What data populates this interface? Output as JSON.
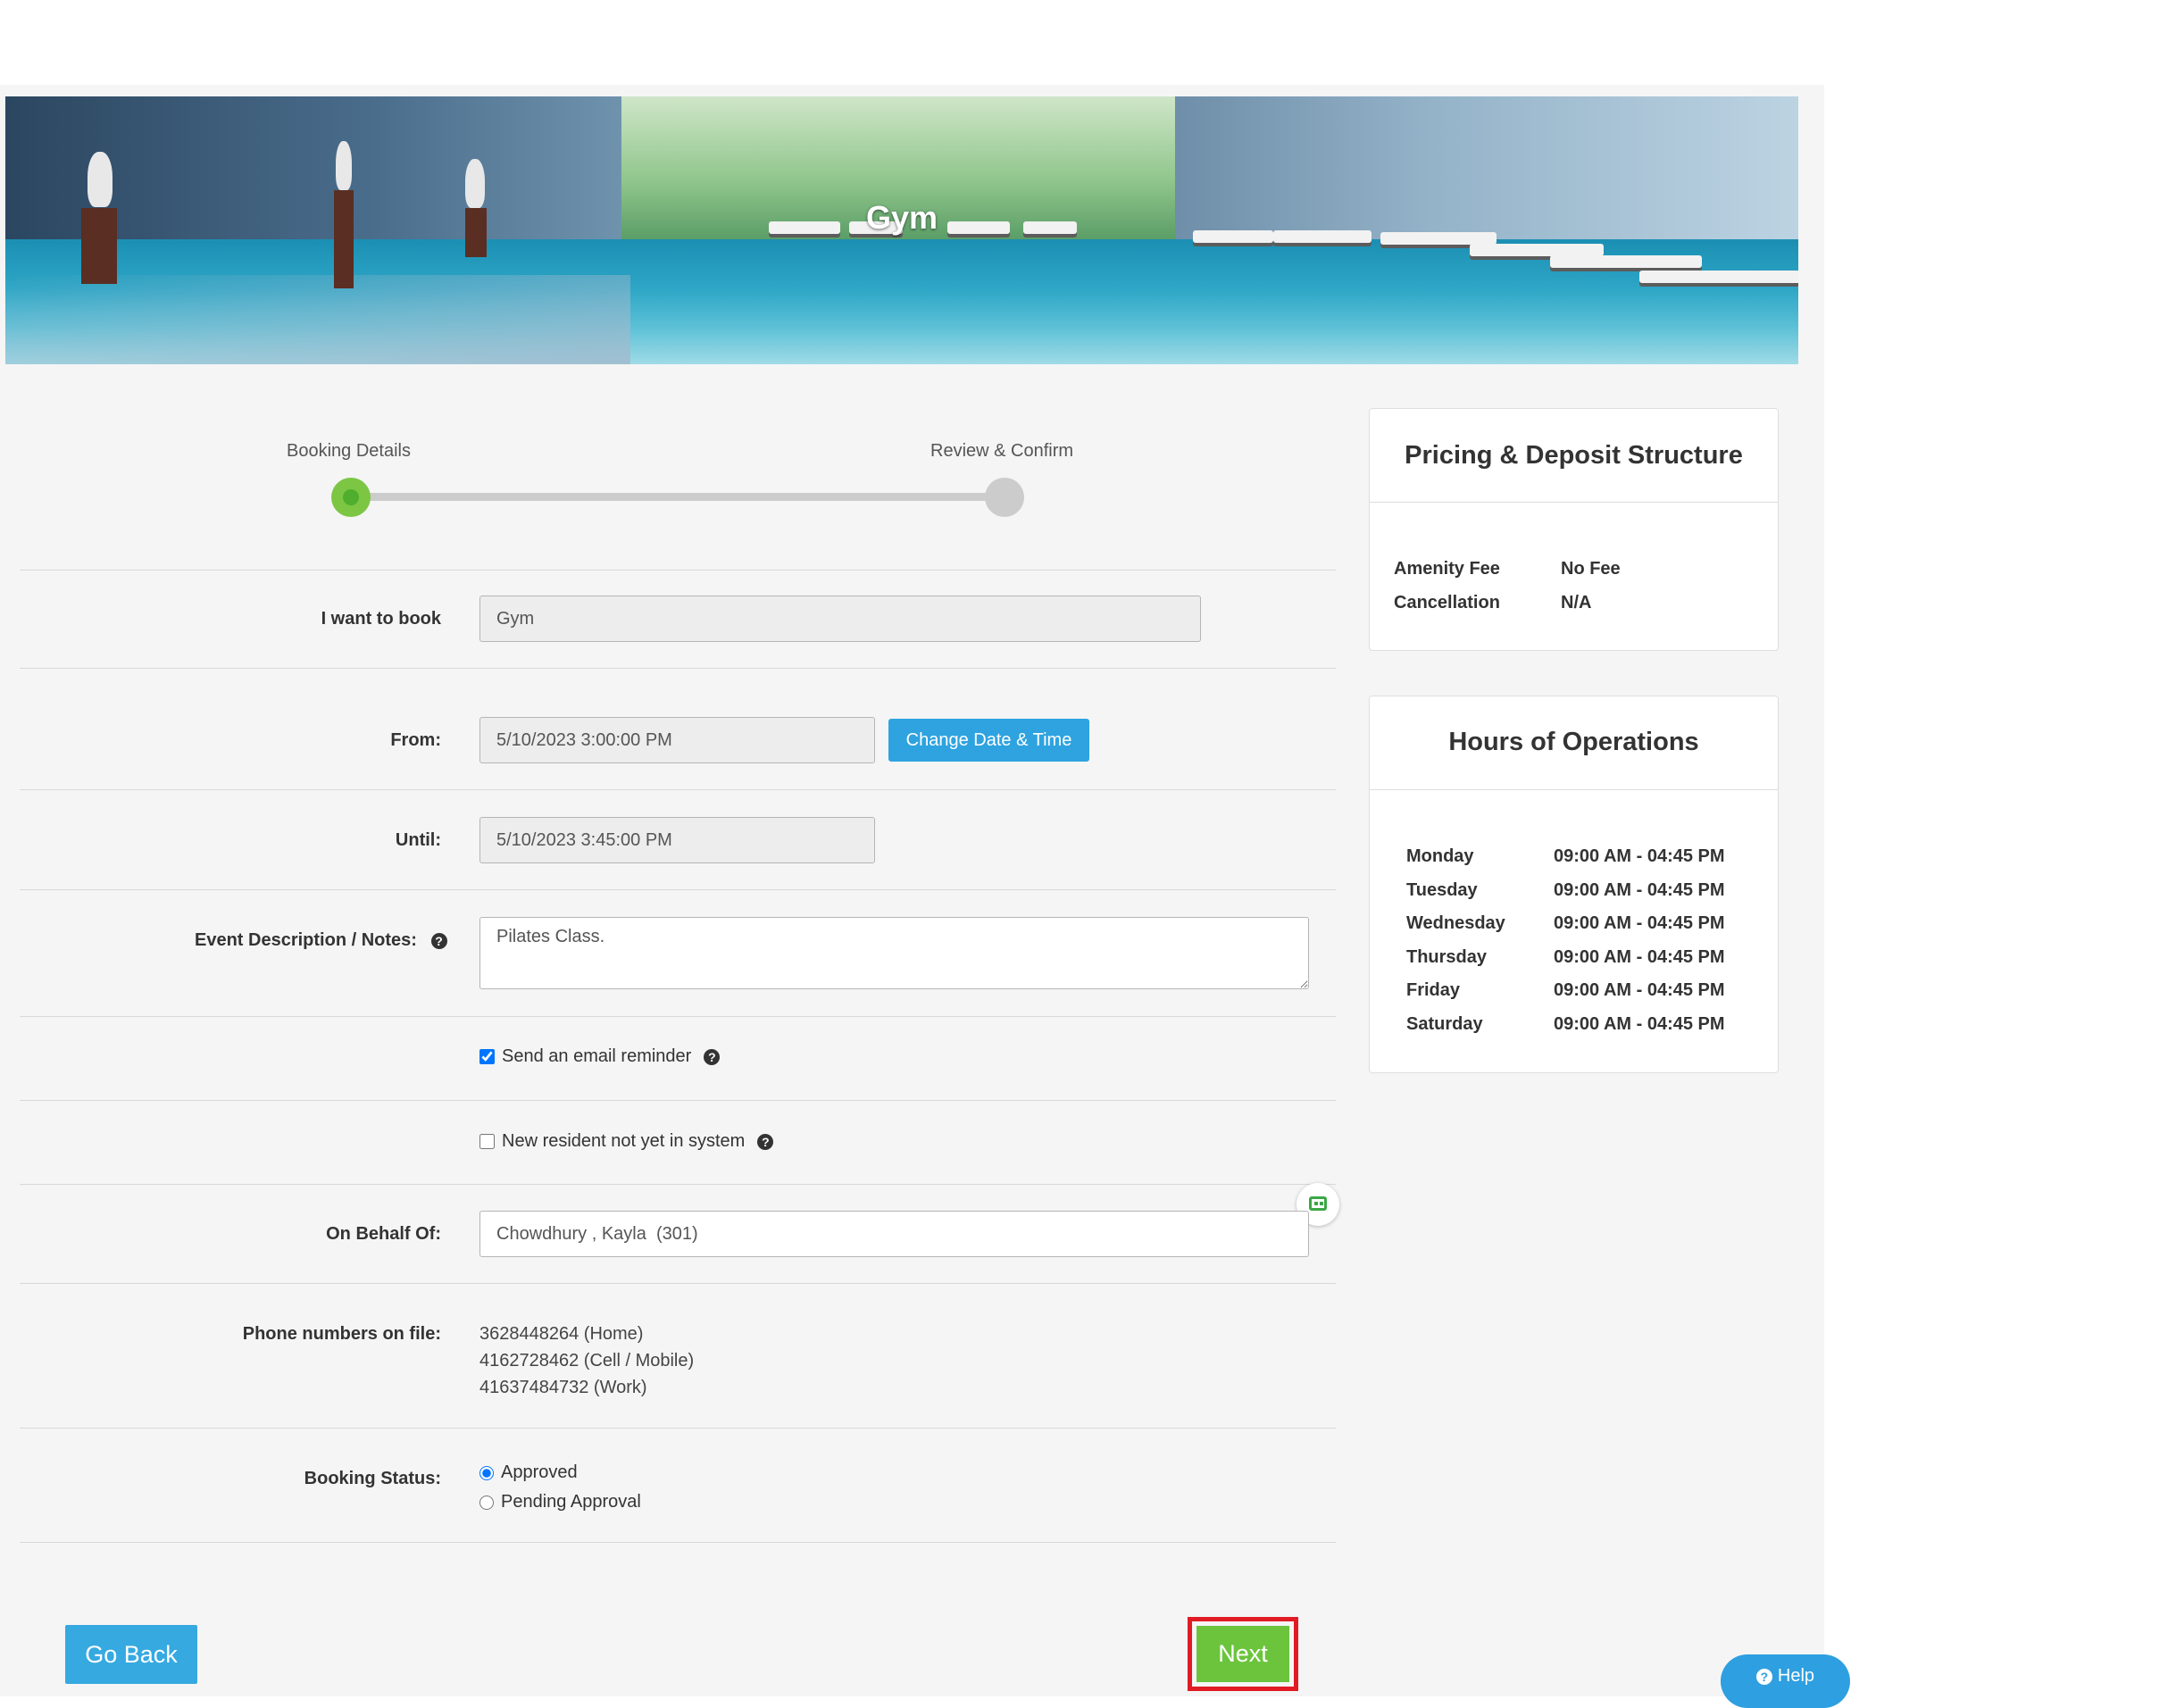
{
  "banner": {
    "title": "Gym"
  },
  "stepper": {
    "step1": "Booking Details",
    "step2": "Review & Confirm"
  },
  "form": {
    "book_label": "I want to book",
    "book_value": "Gym",
    "from_label": "From:",
    "from_value": "5/10/2023 3:00:00 PM",
    "change_button": "Change Date & Time",
    "until_label": "Until:",
    "until_value": "5/10/2023 3:45:00 PM",
    "notes_label": "Event Description / Notes:",
    "notes_value": "Pilates Class.",
    "email_reminder_label": "Send an email reminder",
    "email_reminder_checked": true,
    "new_resident_label": "New resident not yet in system",
    "new_resident_checked": false,
    "behalf_label": "On Behalf Of:",
    "behalf_value": "Chowdhury , Kayla  (301)",
    "phones_label": "Phone numbers on file:",
    "phones": [
      "3628448264 (Home)",
      "4162728462 (Cell / Mobile)",
      "41637484732 (Work)"
    ],
    "status_label": "Booking Status:",
    "status_options": [
      "Approved",
      "Pending Approval"
    ],
    "status_selected": "Approved"
  },
  "buttons": {
    "go_back": "Go Back",
    "next": "Next",
    "help": "Help"
  },
  "pricing": {
    "title": "Pricing & Deposit Structure",
    "rows": [
      {
        "label": "Amenity Fee",
        "value": "No Fee"
      },
      {
        "label": "Cancellation",
        "value": "N/A"
      }
    ]
  },
  "hours": {
    "title": "Hours of Operations",
    "rows": [
      {
        "day": "Monday",
        "time": "09:00 AM - 04:45 PM"
      },
      {
        "day": "Tuesday",
        "time": "09:00 AM - 04:45 PM"
      },
      {
        "day": "Wednesday",
        "time": "09:00 AM - 04:45 PM"
      },
      {
        "day": "Thursday",
        "time": "09:00 AM - 04:45 PM"
      },
      {
        "day": "Friday",
        "time": "09:00 AM - 04:45 PM"
      },
      {
        "day": "Saturday",
        "time": "09:00 AM - 04:45 PM"
      }
    ]
  },
  "colors": {
    "primary": "#2ea3e0",
    "success": "#6cc43d",
    "highlight": "#e01b24"
  },
  "icons": [
    "question-circle-icon",
    "ai-assistant-icon",
    "help-question-icon"
  ]
}
